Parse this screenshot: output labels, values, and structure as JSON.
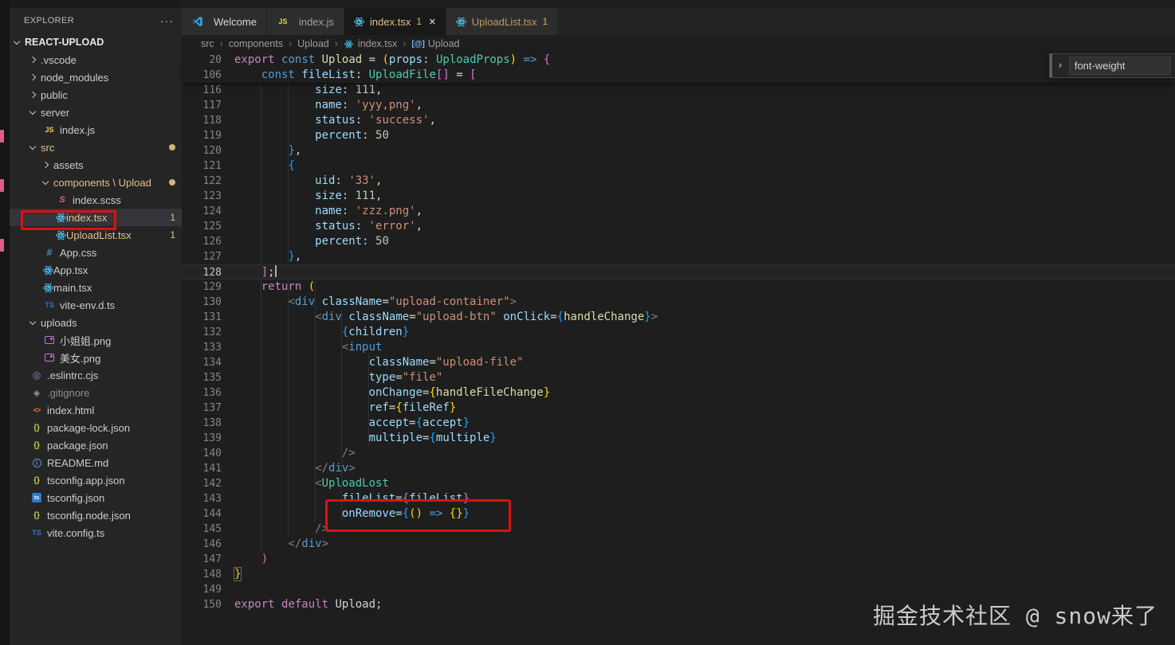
{
  "colors": {
    "annotation_red": "#dd1111",
    "git_modified": "#e2c08d",
    "editor_bg": "#1e1e1e",
    "sidebar_bg": "#252526"
  },
  "watermark": "掘金技术社区 @ snow来了",
  "sidebar": {
    "header": "EXPLORER",
    "actions": "···",
    "section": "REACT-UPLOAD",
    "tree": [
      {
        "label": ".vscode",
        "level": 1,
        "chevron": "r"
      },
      {
        "label": "node_modules",
        "level": 1,
        "chevron": "r"
      },
      {
        "label": "public",
        "level": 1,
        "chevron": "r"
      },
      {
        "label": "server",
        "level": 1,
        "chevron": "d"
      },
      {
        "label": "index.js",
        "level": 2,
        "icon": "js"
      },
      {
        "label": "src",
        "level": 1,
        "chevron": "d",
        "mod": true,
        "dot": true
      },
      {
        "label": "assets",
        "level": 2,
        "chevron": "r"
      },
      {
        "label": "components \\ Upload",
        "level": 2,
        "chevron": "d",
        "mod": true,
        "dot": true
      },
      {
        "label": "index.scss",
        "level": 3,
        "icon": "sass"
      },
      {
        "label": "index.tsx",
        "level": 3,
        "icon": "react",
        "mod": true,
        "badge": "1",
        "selected": true
      },
      {
        "label": "UploadList.tsx",
        "level": 3,
        "icon": "react",
        "mod": true,
        "badge": "1"
      },
      {
        "label": "App.css",
        "level": 2,
        "icon": "css"
      },
      {
        "label": "App.tsx",
        "level": 2,
        "icon": "react"
      },
      {
        "label": "main.tsx",
        "level": 2,
        "icon": "react"
      },
      {
        "label": "vite-env.d.ts",
        "level": 2,
        "icon": "tstxt"
      },
      {
        "label": "uploads",
        "level": 1,
        "chevron": "d"
      },
      {
        "label": "小姐姐.png",
        "level": 2,
        "icon": "img"
      },
      {
        "label": "美女.png",
        "level": 2,
        "icon": "img"
      },
      {
        "label": ".eslintrc.cjs",
        "level": 1,
        "icon": "eslint"
      },
      {
        "label": ".gitignore",
        "level": 1,
        "icon": "git",
        "dim": true
      },
      {
        "label": "index.html",
        "level": 1,
        "icon": "html"
      },
      {
        "label": "package-lock.json",
        "level": 1,
        "icon": "json"
      },
      {
        "label": "package.json",
        "level": 1,
        "icon": "json"
      },
      {
        "label": "README.md",
        "level": 1,
        "icon": "info"
      },
      {
        "label": "tsconfig.app.json",
        "level": 1,
        "icon": "json"
      },
      {
        "label": "tsconfig.json",
        "level": 1,
        "icon": "tsbox"
      },
      {
        "label": "tsconfig.node.json",
        "level": 1,
        "icon": "json"
      },
      {
        "label": "vite.config.ts",
        "level": 1,
        "icon": "tstxt"
      }
    ]
  },
  "tabs": [
    {
      "key": "welcome",
      "label": "Welcome",
      "icon": "vscode"
    },
    {
      "key": "indexjs",
      "label": "index.js",
      "icon": "js"
    },
    {
      "key": "indextsx",
      "label": "index.tsx",
      "icon": "react",
      "badge": "1",
      "active": true,
      "close": "×"
    },
    {
      "key": "uploadlist",
      "label": "UploadList.tsx",
      "icon": "react",
      "badge": "1"
    }
  ],
  "breadcrumb": [
    {
      "label": "src"
    },
    {
      "label": "components"
    },
    {
      "label": "Upload"
    },
    {
      "label": "index.tsx",
      "icon": "react"
    },
    {
      "label": "Upload",
      "icon": "symbol"
    }
  ],
  "find": {
    "query": "font-weight",
    "chevron": "›"
  },
  "editor": {
    "sticky": [
      {
        "n": "20",
        "t": [
          [
            "export",
            "k"
          ],
          [
            " ",
            "p"
          ],
          [
            "const",
            "c"
          ],
          [
            " ",
            "p"
          ],
          [
            "Upload",
            "f"
          ],
          [
            " = ",
            "p"
          ],
          [
            "(",
            "g"
          ],
          [
            "props",
            "v"
          ],
          [
            ": ",
            "p"
          ],
          [
            "UploadProps",
            "t"
          ],
          [
            ")",
            "g"
          ],
          [
            " ",
            "p"
          ],
          [
            "=>",
            "c"
          ],
          [
            " ",
            "p"
          ],
          [
            "{",
            "m"
          ]
        ]
      },
      {
        "n": "106",
        "t": [
          [
            "    ",
            "p"
          ],
          [
            "const",
            "c"
          ],
          [
            " ",
            "p"
          ],
          [
            "fileList",
            "v"
          ],
          [
            ": ",
            "p"
          ],
          [
            "UploadFile",
            "t"
          ],
          [
            "[]",
            "m"
          ],
          [
            " = ",
            "p"
          ],
          [
            "[",
            "m"
          ]
        ]
      }
    ],
    "lines": [
      {
        "n": "116",
        "t": [
          [
            "            ",
            "p"
          ],
          [
            "size",
            "v"
          ],
          [
            ": ",
            "p"
          ],
          [
            "111",
            "n"
          ],
          [
            ",",
            "p"
          ]
        ]
      },
      {
        "n": "117",
        "t": [
          [
            "            ",
            "p"
          ],
          [
            "name",
            "v"
          ],
          [
            ": ",
            "p"
          ],
          [
            "'yyy,png'",
            "s"
          ],
          [
            ",",
            "p"
          ]
        ]
      },
      {
        "n": "118",
        "t": [
          [
            "            ",
            "p"
          ],
          [
            "status",
            "v"
          ],
          [
            ": ",
            "p"
          ],
          [
            "'success'",
            "s"
          ],
          [
            ",",
            "p"
          ]
        ]
      },
      {
        "n": "119",
        "t": [
          [
            "            ",
            "p"
          ],
          [
            "percent",
            "v"
          ],
          [
            ": ",
            "p"
          ],
          [
            "50",
            "n"
          ]
        ]
      },
      {
        "n": "120",
        "t": [
          [
            "        ",
            "p"
          ],
          [
            "}",
            "b"
          ],
          [
            ",",
            "p"
          ]
        ]
      },
      {
        "n": "121",
        "t": [
          [
            "        ",
            "p"
          ],
          [
            "{",
            "b"
          ]
        ]
      },
      {
        "n": "122",
        "t": [
          [
            "            ",
            "p"
          ],
          [
            "uid",
            "v"
          ],
          [
            ": ",
            "p"
          ],
          [
            "'33'",
            "s"
          ],
          [
            ",",
            "p"
          ]
        ]
      },
      {
        "n": "123",
        "t": [
          [
            "            ",
            "p"
          ],
          [
            "size",
            "v"
          ],
          [
            ": ",
            "p"
          ],
          [
            "111",
            "n"
          ],
          [
            ",",
            "p"
          ]
        ]
      },
      {
        "n": "124",
        "t": [
          [
            "            ",
            "p"
          ],
          [
            "name",
            "v"
          ],
          [
            ": ",
            "p"
          ],
          [
            "'zzz.png'",
            "s"
          ],
          [
            ",",
            "p"
          ]
        ]
      },
      {
        "n": "125",
        "t": [
          [
            "            ",
            "p"
          ],
          [
            "status",
            "v"
          ],
          [
            ": ",
            "p"
          ],
          [
            "'error'",
            "s"
          ],
          [
            ",",
            "p"
          ]
        ]
      },
      {
        "n": "126",
        "t": [
          [
            "            ",
            "p"
          ],
          [
            "percent",
            "v"
          ],
          [
            ": ",
            "p"
          ],
          [
            "50",
            "n"
          ]
        ]
      },
      {
        "n": "127",
        "t": [
          [
            "        ",
            "p"
          ],
          [
            "}",
            "b"
          ],
          [
            ",",
            "p"
          ]
        ]
      },
      {
        "n": "128",
        "cur": true,
        "t": [
          [
            "    ",
            "p"
          ],
          [
            "]",
            "m"
          ],
          [
            ";",
            "p"
          ]
        ]
      },
      {
        "n": "129",
        "t": [
          [
            "    ",
            "p"
          ],
          [
            "return",
            "k"
          ],
          [
            " ",
            "p"
          ],
          [
            "(",
            "g"
          ]
        ]
      },
      {
        "n": "130",
        "t": [
          [
            "        ",
            "p"
          ],
          [
            "<",
            "a"
          ],
          [
            "div",
            "c"
          ],
          [
            " ",
            "p"
          ],
          [
            "className",
            "v"
          ],
          [
            "=",
            "p"
          ],
          [
            "\"upload-container\"",
            "s"
          ],
          [
            ">",
            "a"
          ]
        ]
      },
      {
        "n": "131",
        "t": [
          [
            "            ",
            "p"
          ],
          [
            "<",
            "a"
          ],
          [
            "div",
            "c"
          ],
          [
            " ",
            "p"
          ],
          [
            "className",
            "v"
          ],
          [
            "=",
            "p"
          ],
          [
            "\"upload-btn\"",
            "s"
          ],
          [
            " ",
            "p"
          ],
          [
            "onClick",
            "v"
          ],
          [
            "=",
            "p"
          ],
          [
            "{",
            "b"
          ],
          [
            "handleChange",
            "f"
          ],
          [
            "}",
            "b"
          ],
          [
            ">",
            "a"
          ]
        ]
      },
      {
        "n": "132",
        "t": [
          [
            "                ",
            "p"
          ],
          [
            "{",
            "b"
          ],
          [
            "children",
            "v"
          ],
          [
            "}",
            "b"
          ]
        ]
      },
      {
        "n": "133",
        "t": [
          [
            "                ",
            "p"
          ],
          [
            "<",
            "a"
          ],
          [
            "input",
            "c"
          ]
        ]
      },
      {
        "n": "134",
        "t": [
          [
            "                    ",
            "p"
          ],
          [
            "className",
            "v"
          ],
          [
            "=",
            "p"
          ],
          [
            "\"upload-file\"",
            "s"
          ]
        ]
      },
      {
        "n": "135",
        "t": [
          [
            "                    ",
            "p"
          ],
          [
            "type",
            "v"
          ],
          [
            "=",
            "p"
          ],
          [
            "\"file\"",
            "s"
          ]
        ]
      },
      {
        "n": "136",
        "t": [
          [
            "                    ",
            "p"
          ],
          [
            "onChange",
            "v"
          ],
          [
            "=",
            "p"
          ],
          [
            "{",
            "g"
          ],
          [
            "handleFileChange",
            "f"
          ],
          [
            "}",
            "g"
          ]
        ]
      },
      {
        "n": "137",
        "t": [
          [
            "                    ",
            "p"
          ],
          [
            "ref",
            "v"
          ],
          [
            "=",
            "p"
          ],
          [
            "{",
            "g"
          ],
          [
            "fileRef",
            "v"
          ],
          [
            "}",
            "g"
          ]
        ]
      },
      {
        "n": "138",
        "t": [
          [
            "                    ",
            "p"
          ],
          [
            "accept",
            "v"
          ],
          [
            "=",
            "p"
          ],
          [
            "{",
            "b"
          ],
          [
            "accept",
            "v"
          ],
          [
            "}",
            "b"
          ]
        ]
      },
      {
        "n": "139",
        "t": [
          [
            "                    ",
            "p"
          ],
          [
            "multiple",
            "v"
          ],
          [
            "=",
            "p"
          ],
          [
            "{",
            "b"
          ],
          [
            "multiple",
            "v"
          ],
          [
            "}",
            "b"
          ]
        ]
      },
      {
        "n": "140",
        "t": [
          [
            "                ",
            "p"
          ],
          [
            "/>",
            "a"
          ]
        ]
      },
      {
        "n": "141",
        "t": [
          [
            "            ",
            "p"
          ],
          [
            "</",
            "a"
          ],
          [
            "div",
            "c"
          ],
          [
            ">",
            "a"
          ]
        ]
      },
      {
        "n": "142",
        "t": [
          [
            "            ",
            "p"
          ],
          [
            "<",
            "a"
          ],
          [
            "UploadLost",
            "t"
          ]
        ]
      },
      {
        "n": "143",
        "t": [
          [
            "                ",
            "p"
          ],
          [
            "fileList",
            "v"
          ],
          [
            "=",
            "p"
          ],
          [
            "{",
            "m"
          ],
          [
            "fileList",
            "v"
          ],
          [
            "}",
            "m"
          ]
        ]
      },
      {
        "n": "144",
        "t": [
          [
            "                ",
            "p"
          ],
          [
            "onRemove",
            "v"
          ],
          [
            "=",
            "p"
          ],
          [
            "{",
            "b"
          ],
          [
            "()",
            "g"
          ],
          [
            " ",
            "p"
          ],
          [
            "=>",
            "c"
          ],
          [
            " ",
            "p"
          ],
          [
            "{}",
            "g"
          ],
          [
            "}",
            "b"
          ]
        ]
      },
      {
        "n": "145",
        "t": [
          [
            "            ",
            "p"
          ],
          [
            "/>",
            "a"
          ]
        ]
      },
      {
        "n": "146",
        "t": [
          [
            "        ",
            "p"
          ],
          [
            "</",
            "a"
          ],
          [
            "div",
            "c"
          ],
          [
            ">",
            "a"
          ]
        ]
      },
      {
        "n": "147",
        "t": [
          [
            "    ",
            "p"
          ],
          [
            ")",
            "m"
          ]
        ]
      },
      {
        "n": "148",
        "t": [
          [
            "}",
            "gx"
          ]
        ]
      },
      {
        "n": "149",
        "t": []
      },
      {
        "n": "150",
        "t": [
          [
            "export",
            "k"
          ],
          [
            " ",
            "p"
          ],
          [
            "default",
            "k"
          ],
          [
            " ",
            "p"
          ],
          [
            "Upload",
            "p"
          ],
          [
            ";",
            "p"
          ]
        ]
      }
    ]
  }
}
